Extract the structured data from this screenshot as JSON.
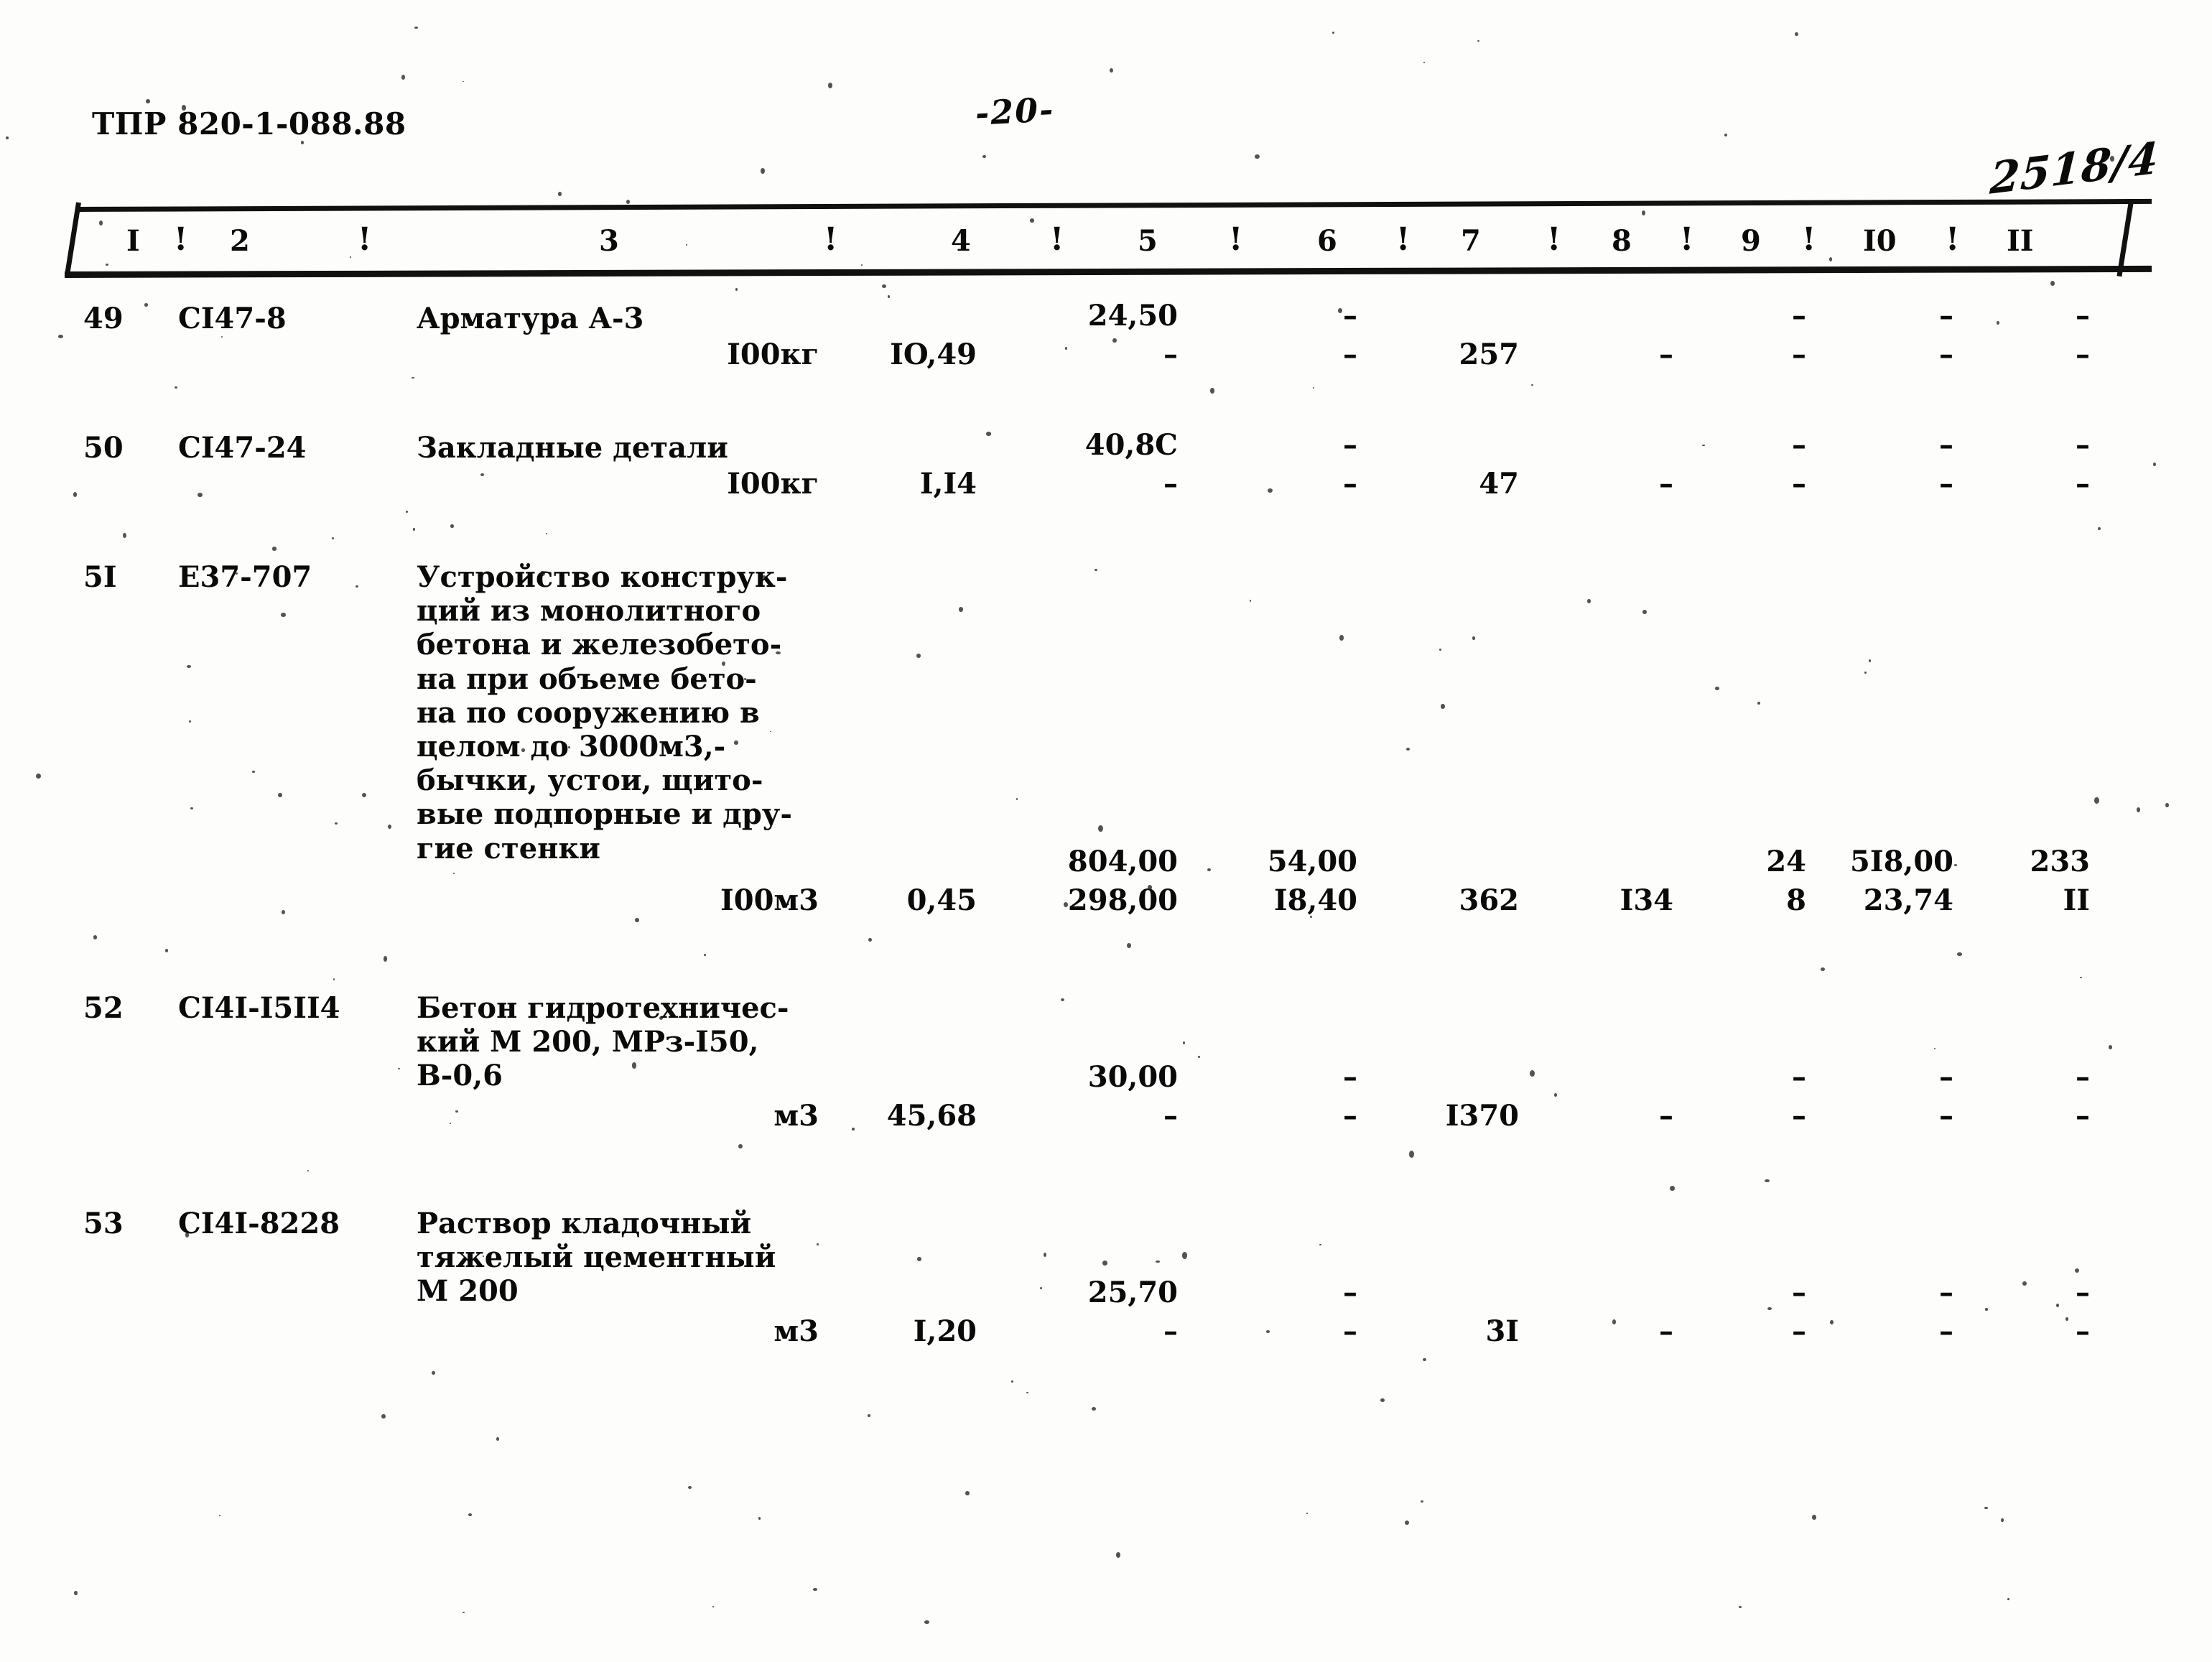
{
  "document": {
    "code": "ТПР 820-1-088.88",
    "page_number": "-20-",
    "archive_mark": "2518/4"
  },
  "table": {
    "column_headers": [
      "I",
      "2",
      "3",
      "4",
      "5",
      "6",
      "7",
      "8",
      "9",
      "I0",
      "II"
    ],
    "separator": "!",
    "rows": [
      {
        "num": "49",
        "code": "СI47-8",
        "description": [
          "Арматура А-3"
        ],
        "unit": "I00кг",
        "qty": "IO,49",
        "c5_top": "24,50",
        "c5_bottom": "–",
        "c6_top": "–",
        "c6_bottom": "–",
        "c7_top": "",
        "c7_bottom": "257",
        "c8_top": "",
        "c8_bottom": "–",
        "c9_top": "–",
        "c9_bottom": "–",
        "c10_top": "–",
        "c10_bottom": "–",
        "c11_top": "–",
        "c11_bottom": "–"
      },
      {
        "num": "50",
        "code": "СI47-24",
        "description": [
          "Закладные детали"
        ],
        "unit": "I00кг",
        "qty": "I,I4",
        "c5_top": "40,8C",
        "c5_bottom": "–",
        "c6_top": "–",
        "c6_bottom": "–",
        "c7_top": "",
        "c7_bottom": "47",
        "c8_top": "",
        "c8_bottom": "–",
        "c9_top": "–",
        "c9_bottom": "–",
        "c10_top": "–",
        "c10_bottom": "–",
        "c11_top": "–",
        "c11_bottom": "–"
      },
      {
        "num": "5I",
        "code": "Е37-707",
        "description": [
          "Устройство конструк-",
          "ций из монолитного",
          "бетона и железобето-",
          "на при объеме бето-",
          "на по сооружению в",
          "целом до 3000м3,-",
          "бычки, устои, щито-",
          "вые подпорные и дру-",
          "гие стенки"
        ],
        "unit": "I00м3",
        "qty": "0,45",
        "c5_top": "804,00",
        "c5_bottom": "298,00",
        "c6_top": "54,00",
        "c6_bottom": "I8,40",
        "c7_top": "",
        "c7_bottom": "362",
        "c8_top": "",
        "c8_bottom": "I34",
        "c9_top": "24",
        "c9_bottom": "8",
        "c10_top": "5I8,00",
        "c10_bottom": "23,74",
        "c11_top": "233",
        "c11_bottom": "II"
      },
      {
        "num": "52",
        "code": "СI4I-I5II4",
        "description": [
          "Бетон гидротехничес-",
          "кий М 200, МРз-I50,",
          "В-0,6"
        ],
        "unit": "м3",
        "qty": "45,68",
        "c5_top": "30,00",
        "c5_bottom": "–",
        "c6_top": "–",
        "c6_bottom": "–",
        "c7_top": "",
        "c7_bottom": "I370",
        "c8_top": "",
        "c8_bottom": "–",
        "c9_top": "–",
        "c9_bottom": "–",
        "c10_top": "–",
        "c10_bottom": "–",
        "c11_top": "–",
        "c11_bottom": "–"
      },
      {
        "num": "53",
        "code": "СI4I-8228",
        "description": [
          "Раствор кладочный",
          "тяжелый цементный",
          "М 200"
        ],
        "unit": "м3",
        "qty": "I,20",
        "c5_top": "25,70",
        "c5_bottom": "–",
        "c6_top": "–",
        "c6_bottom": "–",
        "c7_top": "",
        "c7_bottom": "3I",
        "c8_top": "",
        "c8_bottom": "–",
        "c9_top": "–",
        "c9_bottom": "–",
        "c10_top": "–",
        "c10_bottom": "–",
        "c11_top": "–",
        "c11_bottom": "–"
      }
    ]
  }
}
